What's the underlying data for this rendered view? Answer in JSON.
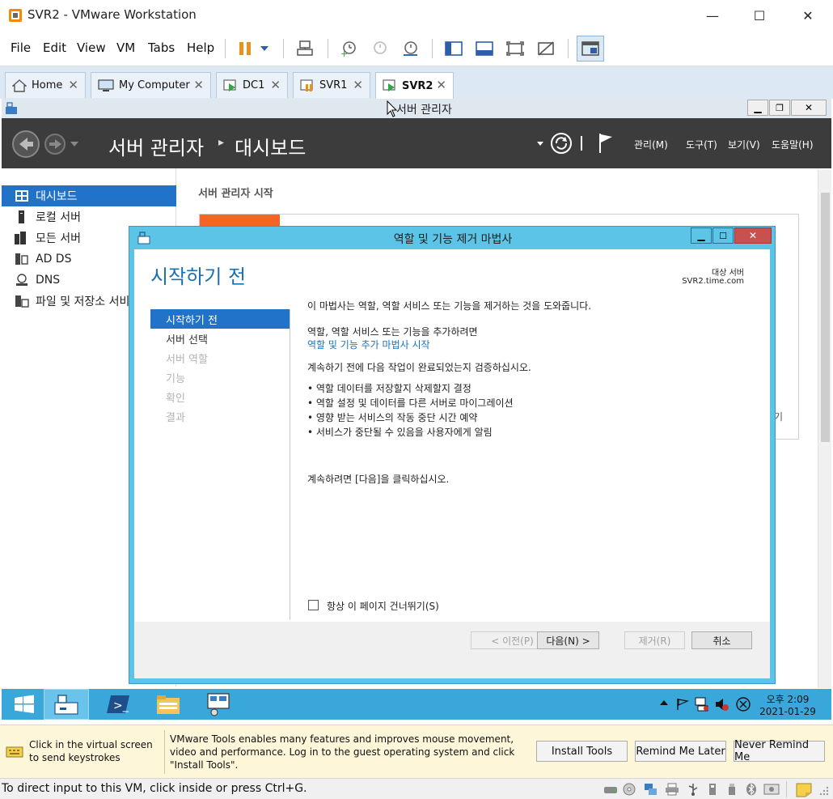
{
  "window": {
    "title": "SVR2 - VMware Workstation",
    "minimize": "—",
    "maximize": "☐",
    "close": "✕"
  },
  "menu": [
    "File",
    "Edit",
    "View",
    "VM",
    "Tabs",
    "Help"
  ],
  "tabs": [
    {
      "label": "Home",
      "icon": "home-icon"
    },
    {
      "label": "My Computer",
      "icon": "computer-icon"
    },
    {
      "label": "DC1",
      "icon": "vm-running-icon"
    },
    {
      "label": "SVR1",
      "icon": "vm-paused-icon"
    },
    {
      "label": "SVR2",
      "icon": "vm-running-icon",
      "active": true
    }
  ],
  "tab_close": "✕",
  "guest": {
    "sm_window_title": "서버 관리자",
    "breadcrumb_root": "서버 관리자",
    "breadcrumb_sep": "▸",
    "breadcrumb_page": "대시보드",
    "header_menus": [
      "관리(M)",
      "도구(T)",
      "보기(V)",
      "도움말(H)"
    ],
    "sidebar": [
      {
        "label": "대시보드",
        "icon": "dashboard-icon",
        "selected": true
      },
      {
        "label": "로컬 서버",
        "icon": "local-server-icon"
      },
      {
        "label": "모든 서버",
        "icon": "all-servers-icon"
      },
      {
        "label": "AD DS",
        "icon": "ad-ds-icon"
      },
      {
        "label": "DNS",
        "icon": "dns-icon"
      },
      {
        "label": "파일 및 저장소 서비",
        "icon": "file-storage-icon"
      }
    ],
    "content_heading": "서버 관리자 시작",
    "partial_text": "기"
  },
  "wizard": {
    "title": "역할 및 기능 제거 마법사",
    "page_title": "시작하기 전",
    "dest_label": "대상 서버",
    "dest_server": "SVR2.time.com",
    "steps": [
      {
        "label": "시작하기 전",
        "state": "active"
      },
      {
        "label": "서버 선택",
        "state": "enabled"
      },
      {
        "label": "서버 역할",
        "state": "disabled"
      },
      {
        "label": "기능",
        "state": "disabled"
      },
      {
        "label": "확인",
        "state": "disabled"
      },
      {
        "label": "결과",
        "state": "disabled"
      }
    ],
    "intro": "이 마법사는 역할, 역할 서비스 또는 기능을 제거하는 것을 도와줍니다.",
    "add_text": "역할, 역할 서비스 또는 기능을 추가하려면",
    "add_link": "역할 및 기능 추가 마법사 시작",
    "verify_text": "계속하기 전에 다음 작업이 완료되었는지 검증하십시오.",
    "bullets": [
      "• 역할 데이터를 저장할지 삭제할지 결정",
      "• 역할 설정 및 데이터를 다른 서버로 마이그레이션",
      "• 영향 받는 서비스의 작동 중단 시간 예약",
      "• 서비스가 중단될 수 있음을 사용자에게 알림"
    ],
    "continue_text": "계속하려면 [다음]을 클릭하십시오.",
    "skip_label": "항상 이 페이지 건너뛰기(S)",
    "btn_prev": "< 이전(P)",
    "btn_next": "다음(N) >",
    "btn_remove": "제거(R)",
    "btn_cancel": "취소"
  },
  "guest_taskbar": {
    "time": "오후 2:09",
    "date": "2021-01-29"
  },
  "notification": {
    "hint": "Click in the virtual screen to send keystrokes",
    "message": "VMware Tools enables many features and improves mouse movement, video and performance. Log in to the guest operating system and click \"Install Tools\".",
    "install": "Install Tools",
    "remind": "Remind Me Later",
    "never": "Never Remind Me"
  },
  "status": "To direct input to this VM, click inside or press Ctrl+G.",
  "colors": {
    "accent": "#2173c9",
    "wizard_frame": "#5cc4e6",
    "taskbar": "#3aa7da",
    "tile_orange": "#f26522",
    "link": "#1a73b8"
  }
}
